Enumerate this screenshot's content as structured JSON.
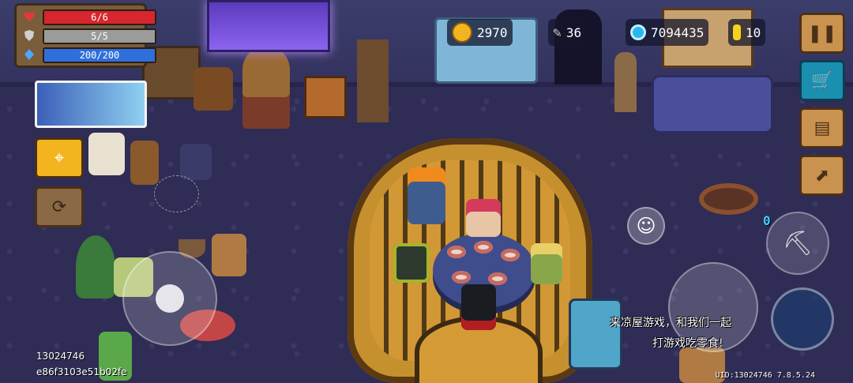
{
  "stats": {
    "hp": "6/6",
    "armor": "5/5",
    "energy": "200/200",
    "hp_fill": 1.0,
    "armor_fill": 1.0,
    "energy_fill": 1.0,
    "colors": {
      "hp": "#d7262e",
      "armor": "#9b9b9b",
      "energy": "#2f6fdc"
    }
  },
  "resources": {
    "trophies": "2970",
    "fish": "36",
    "gems": "7094435",
    "coins": "10"
  },
  "right_buttons": [
    "pause-icon",
    "shop-cart-icon",
    "profile-card-icon",
    "upgrade-arrow-icon"
  ],
  "left_buttons": [
    "location-pin-icon",
    "refresh-arrows-icon"
  ],
  "weapon": {
    "ammo": "0",
    "icon": "pickaxe-icon"
  },
  "chat_message": {
    "line1": "来凉屋游戏，和我们一起",
    "line2": "打游戏吃零食!"
  },
  "player_ids": {
    "id": "13024746",
    "hash": "e86f3103e51b02fe"
  },
  "uid_version": "UID:13024746 7.8.5.24"
}
